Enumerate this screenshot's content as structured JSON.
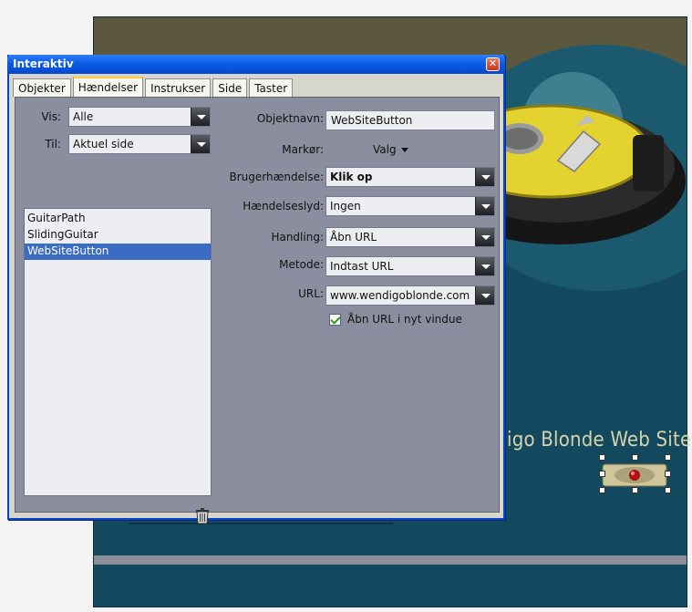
{
  "canvas": {
    "site_title": "igo Blonde Web Site"
  },
  "window": {
    "title": "Interaktiv",
    "close_icon": "close-icon"
  },
  "tabs": [
    {
      "label": "Objekter"
    },
    {
      "label": "Hændelser",
      "active": true
    },
    {
      "label": "Instrukser"
    },
    {
      "label": "Side"
    },
    {
      "label": "Taster"
    }
  ],
  "filters": {
    "vis_label": "Vis:",
    "vis_value": "Alle",
    "til_label": "Til:",
    "til_value": "Aktuel side"
  },
  "objects": {
    "items": [
      "GuitarPath",
      "SlidingGuitar",
      "WebSiteButton"
    ],
    "selected_index": 2
  },
  "properties": {
    "objektnavn_label": "Objektnavn:",
    "objektnavn_value": "WebSiteButton",
    "markor_label": "Markør:",
    "markor_value": "Valg",
    "brugerhaendelse_label": "Brugerhændelse:",
    "brugerhaendelse_value": "Klik op",
    "haendelseslyd_label": "Hændelseslyd:",
    "haendelseslyd_value": "Ingen",
    "handling_label": "Handling:",
    "handling_value": "Åbn URL",
    "metode_label": "Metode:",
    "metode_value": "Indtast URL",
    "url_label": "URL:",
    "url_value": "www.wendigoblonde.com",
    "new_window_label": "Åbn URL i nyt vindue",
    "new_window_checked": true
  },
  "icons": {
    "trash": "trash-icon",
    "dropdown": "chevron-down-icon"
  },
  "colors": {
    "titlebar": "#0a5de6",
    "panel": "#8b8e9f",
    "selection": "#3a6cc4",
    "canvas_teal": "#13495e",
    "canvas_olive": "#5c5840"
  }
}
